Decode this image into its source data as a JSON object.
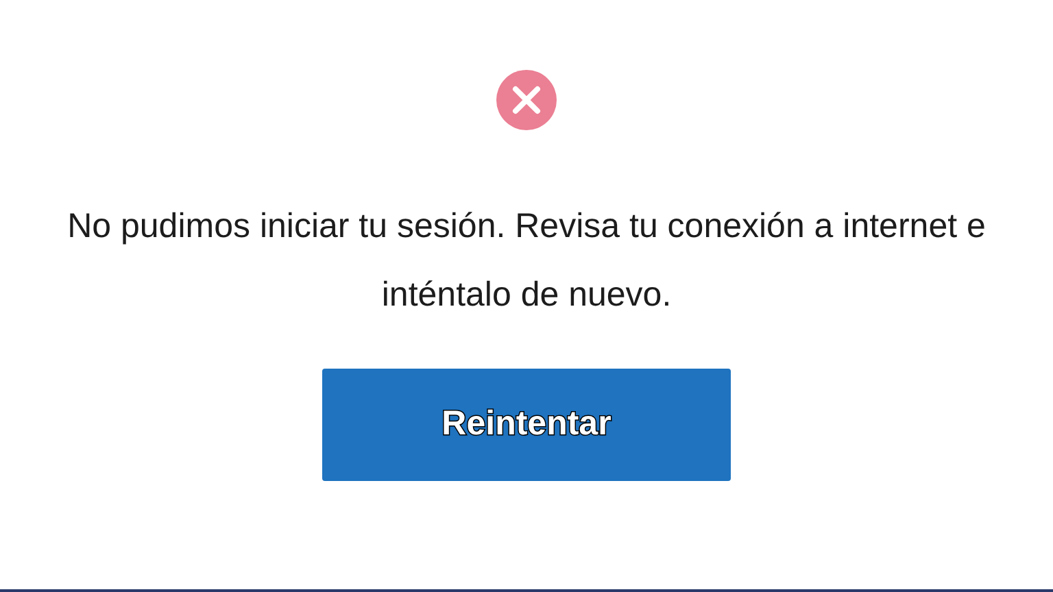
{
  "error_message": "No pudimos iniciar tu sesión. Revisa tu conexión a internet e inténtalo de nuevo.",
  "retry_button": {
    "label": "Reintentar"
  }
}
